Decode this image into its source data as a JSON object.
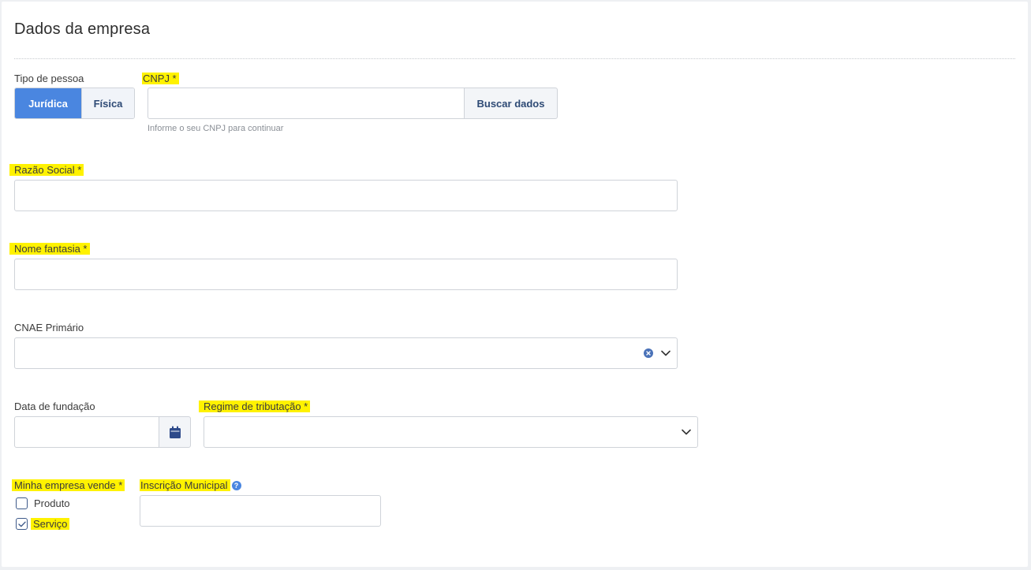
{
  "section_title": "Dados da empresa",
  "tipo_pessoa": {
    "label": "Tipo de pessoa",
    "options": [
      "Jurídica",
      "Física"
    ],
    "selected": "Jurídica"
  },
  "cnpj": {
    "label": "CNPJ *",
    "value": "",
    "button_label": "Buscar dados",
    "help_text": "Informe o seu CNPJ para continuar"
  },
  "razao_social": {
    "label": "Razão Social *",
    "value": ""
  },
  "nome_fantasia": {
    "label": "Nome fantasia *",
    "value": ""
  },
  "cnae": {
    "label": "CNAE Primário",
    "value": ""
  },
  "data_fundacao": {
    "label": "Data de fundação",
    "value": ""
  },
  "regime_tributacao": {
    "label": "Regime de tributação *",
    "value": ""
  },
  "vende": {
    "label": "Minha empresa vende *",
    "options": [
      {
        "label": "Produto",
        "checked": false
      },
      {
        "label": "Serviço",
        "checked": true
      }
    ]
  },
  "inscricao_municipal": {
    "label": "Inscrição Municipal",
    "value": ""
  },
  "colors": {
    "accent": "#4a86e0",
    "highlight": "#fff200",
    "border": "#cfd3d9"
  },
  "icons": {
    "clear": "clear-circle-icon",
    "dropdown": "chevron-down-icon",
    "calendar": "calendar-icon",
    "help": "question-circle-icon",
    "check": "check-icon"
  }
}
